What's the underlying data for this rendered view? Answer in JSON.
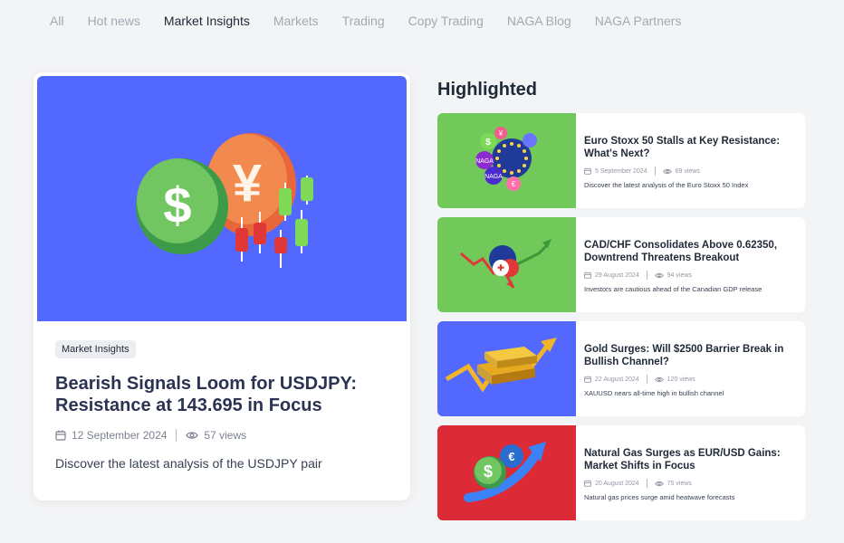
{
  "nav": {
    "tabs": [
      {
        "label": "All",
        "active": false
      },
      {
        "label": "Hot news",
        "active": false
      },
      {
        "label": "Market Insights",
        "active": true
      },
      {
        "label": "Markets",
        "active": false
      },
      {
        "label": "Trading",
        "active": false
      },
      {
        "label": "Copy Trading",
        "active": false
      },
      {
        "label": "NAGA Blog",
        "active": false
      },
      {
        "label": "NAGA Partners",
        "active": false
      }
    ]
  },
  "featured": {
    "category": "Market Insights",
    "title": "Bearish Signals Loom for USDJPY: Resistance at 143.695 in Focus",
    "date": "12 September 2024",
    "views": "57 views",
    "description": "Discover the latest analysis of the USDJPY pair",
    "image_bg": "#5268ff",
    "icons": [
      "calendar-icon",
      "eye-icon"
    ]
  },
  "highlighted": {
    "heading": "Highlighted",
    "articles": [
      {
        "title": "Euro Stoxx 50 Stalls at Key Resistance: What's Next?",
        "date": "5 September 2024",
        "views": "69 views",
        "description": "Discover the latest analysis of the Euro Stoxx 50 Index",
        "image_bg": "#71c95a"
      },
      {
        "title": "CAD/CHF Consolidates Above 0.62350, Downtrend Threatens Breakout",
        "date": "29 August 2024",
        "views": "94 views",
        "description": "Investors are cautious ahead of the Canadian GDP release",
        "image_bg": "#71c95a"
      },
      {
        "title": "Gold Surges: Will $2500 Barrier Break in Bullish Channel?",
        "date": "22 August 2024",
        "views": "120 views",
        "description": "XAUUSD nears all-time high in bullish channel",
        "image_bg": "#5268ff"
      },
      {
        "title": "Natural Gas Surges as EUR/USD Gains: Market Shifts in Focus",
        "date": "20 August 2024",
        "views": "75 views",
        "description": "Natural gas prices surge amid heatwave forecasts",
        "image_bg": "#dc2a37"
      }
    ]
  }
}
